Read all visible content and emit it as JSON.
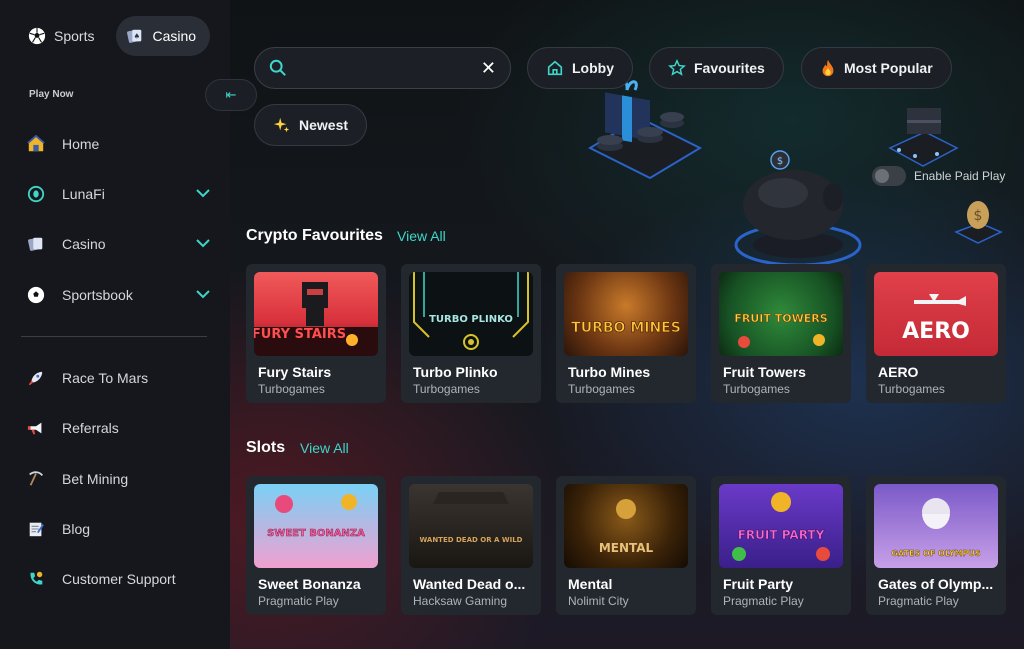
{
  "sidebar": {
    "top_tabs": [
      {
        "label": "Sports",
        "icon": "soccer-ball-icon"
      },
      {
        "label": "Casino",
        "icon": "cards-icon",
        "active": true
      }
    ],
    "play_now": "Play Now",
    "collapse_glyph": "⇤",
    "items": [
      {
        "label": "Home",
        "icon": "home-icon"
      },
      {
        "label": "LunaFi",
        "icon": "lunafi-icon",
        "expandable": true
      },
      {
        "label": "Casino",
        "icon": "cards-icon",
        "expandable": true
      },
      {
        "label": "Sportsbook",
        "icon": "soccer-ball-icon",
        "expandable": true
      },
      {
        "label": "Race To Mars",
        "icon": "rocket-icon"
      },
      {
        "label": "Referrals",
        "icon": "megaphone-icon"
      },
      {
        "label": "Bet Mining",
        "icon": "pickaxe-icon"
      },
      {
        "label": "Blog",
        "icon": "blog-icon"
      },
      {
        "label": "Customer Support",
        "icon": "support-icon"
      }
    ]
  },
  "search": {
    "value": "",
    "placeholder": ""
  },
  "filters": [
    {
      "label": "Lobby",
      "icon": "home-icon"
    },
    {
      "label": "Favourites",
      "icon": "star-icon"
    },
    {
      "label": "Most Popular",
      "icon": "fire-icon"
    },
    {
      "label": "Newest",
      "icon": "sparkles-icon"
    }
  ],
  "paid_play": {
    "label": "Enable Paid Play",
    "enabled": false
  },
  "sections": [
    {
      "title": "Crypto Favourites",
      "view_all": "View All",
      "games": [
        {
          "name": "Fury Stairs",
          "provider": "Turbogames",
          "art": "FURY STAIRS"
        },
        {
          "name": "Turbo Plinko",
          "provider": "Turbogames",
          "art": "TURBO PLINKO"
        },
        {
          "name": "Turbo Mines",
          "provider": "Turbogames",
          "art": "TURBO MINES"
        },
        {
          "name": "Fruit Towers",
          "provider": "Turbogames",
          "art": "FRUIT TOWERS"
        },
        {
          "name": "AERO",
          "provider": "Turbogames",
          "art": "AERO"
        }
      ]
    },
    {
      "title": "Slots",
      "view_all": "View All",
      "games": [
        {
          "name": "Sweet Bonanza",
          "provider": "Pragmatic Play",
          "art": "SWEET BONANZA"
        },
        {
          "name": "Wanted Dead o...",
          "provider": "Hacksaw Gaming",
          "art": "WANTED DEAD OR A WILD"
        },
        {
          "name": "Mental",
          "provider": "Nolimit City",
          "art": "MENTAL"
        },
        {
          "name": "Fruit Party",
          "provider": "Pragmatic Play",
          "art": "FRUIT PARTY"
        },
        {
          "name": "Gates of Olymp...",
          "provider": "Pragmatic Play",
          "art": "GATES OF OLYMPUS"
        }
      ]
    }
  ]
}
